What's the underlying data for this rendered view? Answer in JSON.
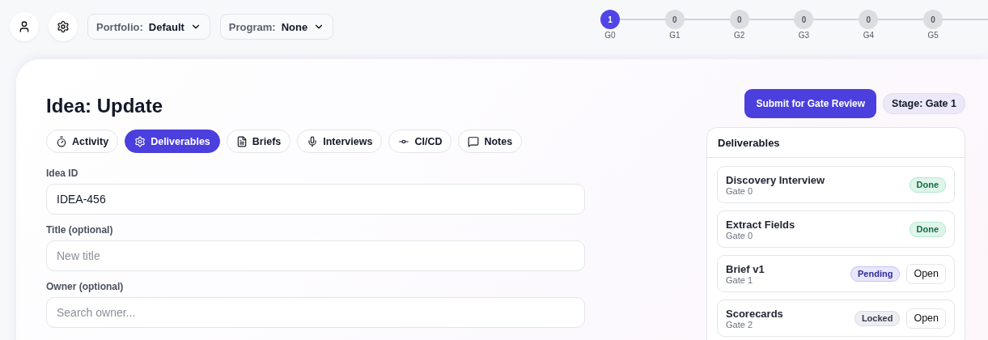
{
  "topbar": {
    "selectors": [
      {
        "label": "Portfolio:",
        "value": "Default"
      },
      {
        "label": "Program:",
        "value": "None"
      }
    ]
  },
  "gates": [
    {
      "count": "1",
      "label": "G0",
      "selected": true
    },
    {
      "count": "0",
      "label": "G1",
      "selected": false
    },
    {
      "count": "0",
      "label": "G2",
      "selected": false
    },
    {
      "count": "0",
      "label": "G3",
      "selected": false
    },
    {
      "count": "0",
      "label": "G4",
      "selected": false
    },
    {
      "count": "0",
      "label": "G5",
      "selected": false
    }
  ],
  "title": "Idea: Update",
  "submit_button": "Submit for Gate Review",
  "stage_badge": "Stage: Gate 1",
  "tabs": [
    {
      "label": "Activity",
      "selected": false
    },
    {
      "label": "Deliverables",
      "selected": true
    },
    {
      "label": "Briefs",
      "selected": false
    },
    {
      "label": "Interviews",
      "selected": false
    },
    {
      "label": "CI/CD",
      "selected": false
    },
    {
      "label": "Notes",
      "selected": false
    }
  ],
  "form": [
    {
      "label": "Idea ID",
      "value": "IDEA-456"
    },
    {
      "label": "Title (optional)",
      "placeholder": "New title"
    },
    {
      "label": "Owner (optional)",
      "placeholder": "Search owner..."
    }
  ],
  "deliverables": {
    "title": "Deliverables",
    "items": [
      {
        "name": "Discovery Interview",
        "gate": "Gate 0",
        "kind": "done",
        "badge": "Done"
      },
      {
        "name": "Extract Fields",
        "gate": "Gate 0",
        "kind": "done",
        "badge": "Done"
      },
      {
        "name": "Brief v1",
        "gate": "Gate 1",
        "kind": "pending",
        "badge": "Pending",
        "action": "Open"
      },
      {
        "name": "Scorecards",
        "gate": "Gate 2",
        "kind": "locked",
        "badge": "Locked",
        "action": "Open"
      }
    ]
  }
}
